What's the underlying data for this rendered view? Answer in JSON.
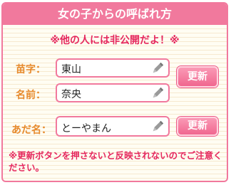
{
  "title": "女の子からの呼ばれ方",
  "notice": "※他の人には非公開だよ！※",
  "name_form": {
    "surname_label": "苗字：",
    "surname_value": "東山",
    "given_label": "名前：",
    "given_value": "奈央",
    "update_label": "更新"
  },
  "nickname_form": {
    "label": "あだ名：",
    "value": "とーやまん",
    "update_label": "更新"
  },
  "footnote": "※更新ボタンを押さないと反映されないのでご注意ください。",
  "colors": {
    "accent_pink": "#f1799d",
    "notice_red": "#e5285e",
    "label_orange": "#e78a2c"
  },
  "icons": {
    "edit": "pencil-icon"
  }
}
